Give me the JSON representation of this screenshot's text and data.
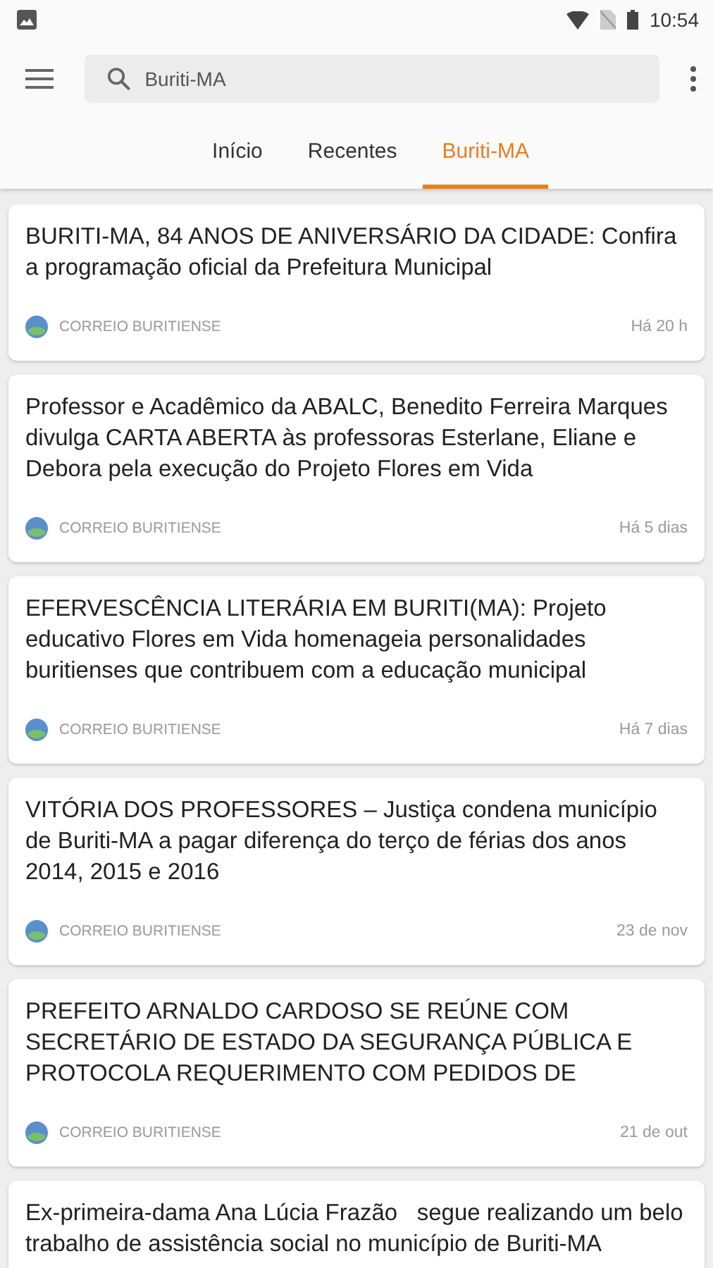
{
  "status_bar": {
    "time": "10:54"
  },
  "toolbar": {
    "search": {
      "value": "Buriti-MA"
    }
  },
  "tabs": [
    {
      "label": "Início",
      "selected": false
    },
    {
      "label": "Recentes",
      "selected": false
    },
    {
      "label": "Buriti-MA",
      "selected": true
    }
  ],
  "articles": [
    {
      "title": "BURITI-MA, 84 ANOS DE ANIVERSÁRIO DA CIDADE: Confira a programação oficial da Prefeitura Municipal",
      "source": "CORREIO BURITIENSE",
      "time": "Há 20 h"
    },
    {
      "title": "Professor e Acadêmico da ABALC, Benedito Ferreira Marques divulga CARTA ABERTA às professoras Esterlane, Eliane e Debora pela execução do Projeto Flores em Vida",
      "source": "CORREIO BURITIENSE",
      "time": "Há 5 dias"
    },
    {
      "title": "EFERVESCÊNCIA LITERÁRIA EM BURITI(MA): Projeto educativo Flores em Vida homenageia personalidades buritienses que contribuem com a educação municipal",
      "source": "CORREIO BURITIENSE",
      "time": "Há 7 dias"
    },
    {
      "title": "VITÓRIA DOS PROFESSORES – Justiça condena município de Buriti-MA a pagar diferença do terço de férias dos anos 2014, 2015 e 2016",
      "source": "CORREIO BURITIENSE",
      "time": "23 de nov"
    },
    {
      "title": "PREFEITO ARNALDO CARDOSO SE REÚNE COM SECRETÁRIO DE ESTADO DA SEGURANÇA PÚBLICA E PROTOCOLA REQUERIMENTO COM PEDIDOS DE",
      "source": "CORREIO BURITIENSE",
      "time": "21 de out"
    },
    {
      "title": "Ex-primeira-dama Ana Lúcia Frazão   segue realizando um belo trabalho de assistência social no município de Buriti-MA"
    }
  ]
}
